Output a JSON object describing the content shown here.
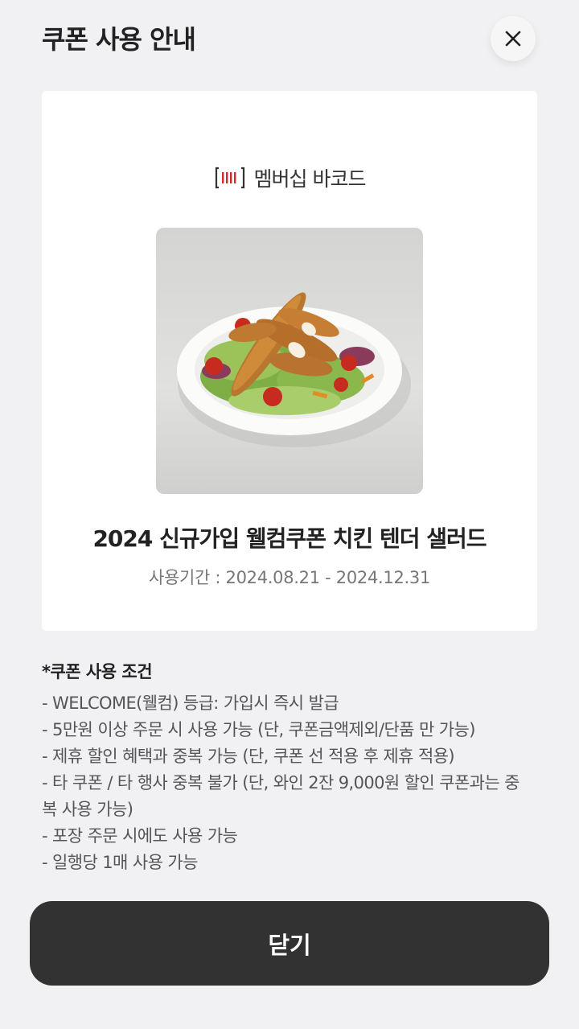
{
  "header": {
    "title": "쿠폰 사용 안내",
    "close_icon": "close-icon"
  },
  "card": {
    "barcode_icon": "barcode-icon",
    "barcode_label": "멤버십 바코드",
    "coupon_name": "2024 신규가입 웰컴쿠폰 치킨 텐더 샐러드",
    "period": "사용기간 : 2024.08.21 - 2024.12.31",
    "accent_color": "#d22b2b"
  },
  "conditions": {
    "title": "*쿠폰 사용 조건",
    "items": [
      "- WELCOME(웰컴) 등급: 가입시 즉시 발급",
      "- 5만원 이상 주문 시 사용 가능 (단, 쿠폰금액제외/단품 만 가능)",
      "- 제휴 할인 혜택과 중복 가능 (단, 쿠폰 선 적용 후 제휴 적용)",
      "- 타 쿠폰 / 타 행사 중복 불가 (단, 와인 2잔 9,000원 할인 쿠폰과는 중복 사용 가능)",
      "- 포장 주문 시에도 사용 가능",
      "- 일행당 1매 사용 가능"
    ]
  },
  "footer": {
    "close_label": "닫기"
  }
}
